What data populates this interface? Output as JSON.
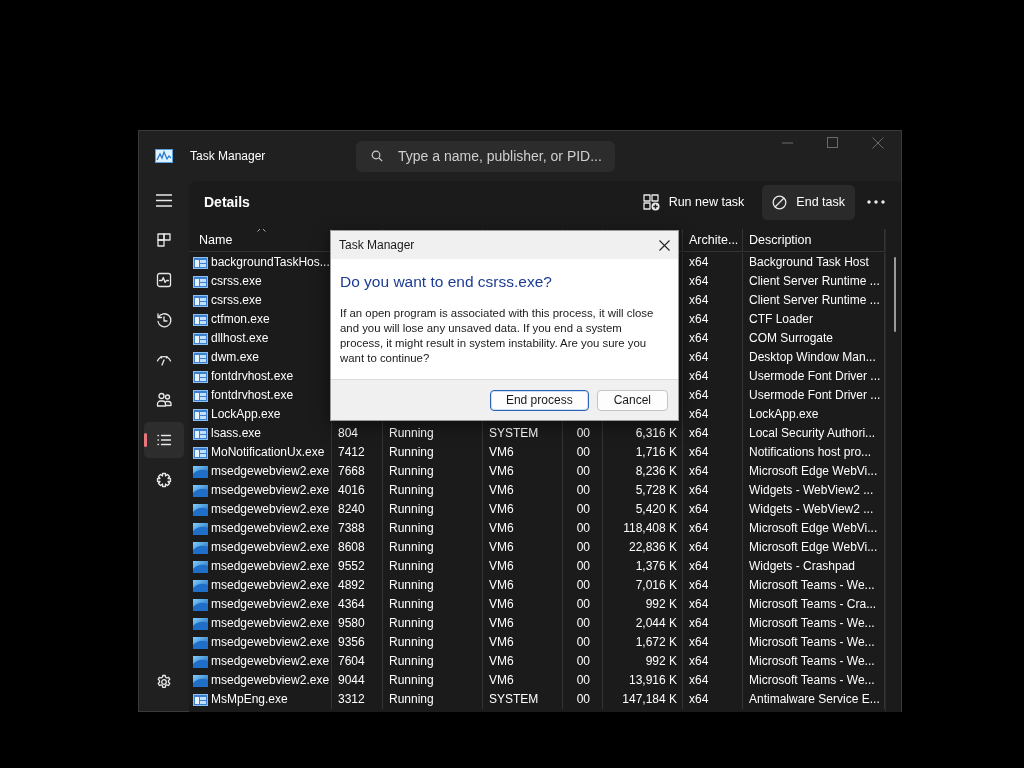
{
  "window": {
    "title": "Task Manager"
  },
  "search": {
    "placeholder": "Type a name, publisher, or PID..."
  },
  "sidebar": {
    "items": [
      {
        "selected": false
      },
      {
        "selected": false
      },
      {
        "selected": false
      },
      {
        "selected": false
      },
      {
        "selected": false
      },
      {
        "selected": true
      },
      {
        "selected": false
      }
    ]
  },
  "page": {
    "title": "Details"
  },
  "commands": [
    {
      "kind": "run",
      "label": "Run new task"
    },
    {
      "kind": "end",
      "label": "End task"
    },
    {
      "kind": "more"
    }
  ],
  "table": {
    "sorted_ascending": true,
    "header": {
      "name": "Name",
      "architecture": "Archite...",
      "description": "Description"
    },
    "rows": [
      {
        "kind": "app",
        "name": "backgroundTaskHos...",
        "architecture": "x64",
        "description": "Background Task Host"
      },
      {
        "kind": "app",
        "name": "csrss.exe",
        "architecture": "x64",
        "description": "Client Server Runtime ..."
      },
      {
        "kind": "app",
        "name": "csrss.exe",
        "architecture": "x64",
        "description": "Client Server Runtime ..."
      },
      {
        "kind": "app",
        "name": "ctfmon.exe",
        "architecture": "x64",
        "description": "CTF Loader"
      },
      {
        "kind": "app",
        "name": "dllhost.exe",
        "architecture": "x64",
        "description": "COM Surrogate"
      },
      {
        "kind": "app",
        "name": "dwm.exe",
        "architecture": "x64",
        "description": "Desktop Window Man..."
      },
      {
        "kind": "app",
        "name": "fontdrvhost.exe",
        "architecture": "x64",
        "description": "Usermode Font Driver ..."
      },
      {
        "kind": "app",
        "name": "fontdrvhost.exe",
        "architecture": "x64",
        "description": "Usermode Font Driver ..."
      },
      {
        "kind": "app",
        "name": "LockApp.exe",
        "architecture": "x64",
        "description": "LockApp.exe"
      },
      {
        "kind": "app",
        "name": "lsass.exe",
        "pid": "804",
        "status": "Running",
        "user": "SYSTEM",
        "cpu": "00",
        "memory": "6,316 K",
        "architecture": "x64",
        "description": "Local Security Authori..."
      },
      {
        "kind": "app",
        "name": "MoNotificationUx.exe",
        "pid": "7412",
        "status": "Running",
        "user": "VM6",
        "cpu": "00",
        "memory": "1,716 K",
        "architecture": "x64",
        "description": "Notifications host pro..."
      },
      {
        "kind": "edge",
        "name": "msedgewebview2.exe",
        "pid": "7668",
        "status": "Running",
        "user": "VM6",
        "cpu": "00",
        "memory": "8,236 K",
        "architecture": "x64",
        "description": "Microsoft Edge WebVi..."
      },
      {
        "kind": "edge",
        "name": "msedgewebview2.exe",
        "pid": "4016",
        "status": "Running",
        "user": "VM6",
        "cpu": "00",
        "memory": "5,728 K",
        "architecture": "x64",
        "description": "Widgets - WebView2 ..."
      },
      {
        "kind": "edge",
        "name": "msedgewebview2.exe",
        "pid": "8240",
        "status": "Running",
        "user": "VM6",
        "cpu": "00",
        "memory": "5,420 K",
        "architecture": "x64",
        "description": "Widgets - WebView2 ..."
      },
      {
        "kind": "edge",
        "name": "msedgewebview2.exe",
        "pid": "7388",
        "status": "Running",
        "user": "VM6",
        "cpu": "00",
        "memory": "118,408 K",
        "architecture": "x64",
        "description": "Microsoft Edge WebVi..."
      },
      {
        "kind": "edge",
        "name": "msedgewebview2.exe",
        "pid": "8608",
        "status": "Running",
        "user": "VM6",
        "cpu": "00",
        "memory": "22,836 K",
        "architecture": "x64",
        "description": "Microsoft Edge WebVi..."
      },
      {
        "kind": "edge",
        "name": "msedgewebview2.exe",
        "pid": "9552",
        "status": "Running",
        "user": "VM6",
        "cpu": "00",
        "memory": "1,376 K",
        "architecture": "x64",
        "description": "Widgets - Crashpad"
      },
      {
        "kind": "edge",
        "name": "msedgewebview2.exe",
        "pid": "4892",
        "status": "Running",
        "user": "VM6",
        "cpu": "00",
        "memory": "7,016 K",
        "architecture": "x64",
        "description": "Microsoft Teams - We..."
      },
      {
        "kind": "edge",
        "name": "msedgewebview2.exe",
        "pid": "4364",
        "status": "Running",
        "user": "VM6",
        "cpu": "00",
        "memory": "992 K",
        "architecture": "x64",
        "description": "Microsoft Teams - Cra..."
      },
      {
        "kind": "edge",
        "name": "msedgewebview2.exe",
        "pid": "9580",
        "status": "Running",
        "user": "VM6",
        "cpu": "00",
        "memory": "2,044 K",
        "architecture": "x64",
        "description": "Microsoft Teams - We..."
      },
      {
        "kind": "edge",
        "name": "msedgewebview2.exe",
        "pid": "9356",
        "status": "Running",
        "user": "VM6",
        "cpu": "00",
        "memory": "1,672 K",
        "architecture": "x64",
        "description": "Microsoft Teams - We..."
      },
      {
        "kind": "edge",
        "name": "msedgewebview2.exe",
        "pid": "7604",
        "status": "Running",
        "user": "VM6",
        "cpu": "00",
        "memory": "992 K",
        "architecture": "x64",
        "description": "Microsoft Teams - We..."
      },
      {
        "kind": "edge",
        "name": "msedgewebview2.exe",
        "pid": "9044",
        "status": "Running",
        "user": "VM6",
        "cpu": "00",
        "memory": "13,916 K",
        "architecture": "x64",
        "description": "Microsoft Teams - We..."
      },
      {
        "kind": "app",
        "name": "MsMpEng.exe",
        "pid": "3312",
        "status": "Running",
        "user": "SYSTEM",
        "cpu": "00",
        "memory": "147,184 K",
        "architecture": "x64",
        "description": "Antimalware Service E..."
      }
    ]
  },
  "dialog": {
    "title": "Task Manager",
    "heading": "Do you want to end csrss.exe?",
    "message": "If an open program is associated with this process, it will close and you will lose any unsaved data. If you end a system process, it might result in system instability. Are you sure you want to continue?",
    "buttons": [
      {
        "label": "End process",
        "default": true
      },
      {
        "label": "Cancel",
        "default": false
      }
    ]
  }
}
